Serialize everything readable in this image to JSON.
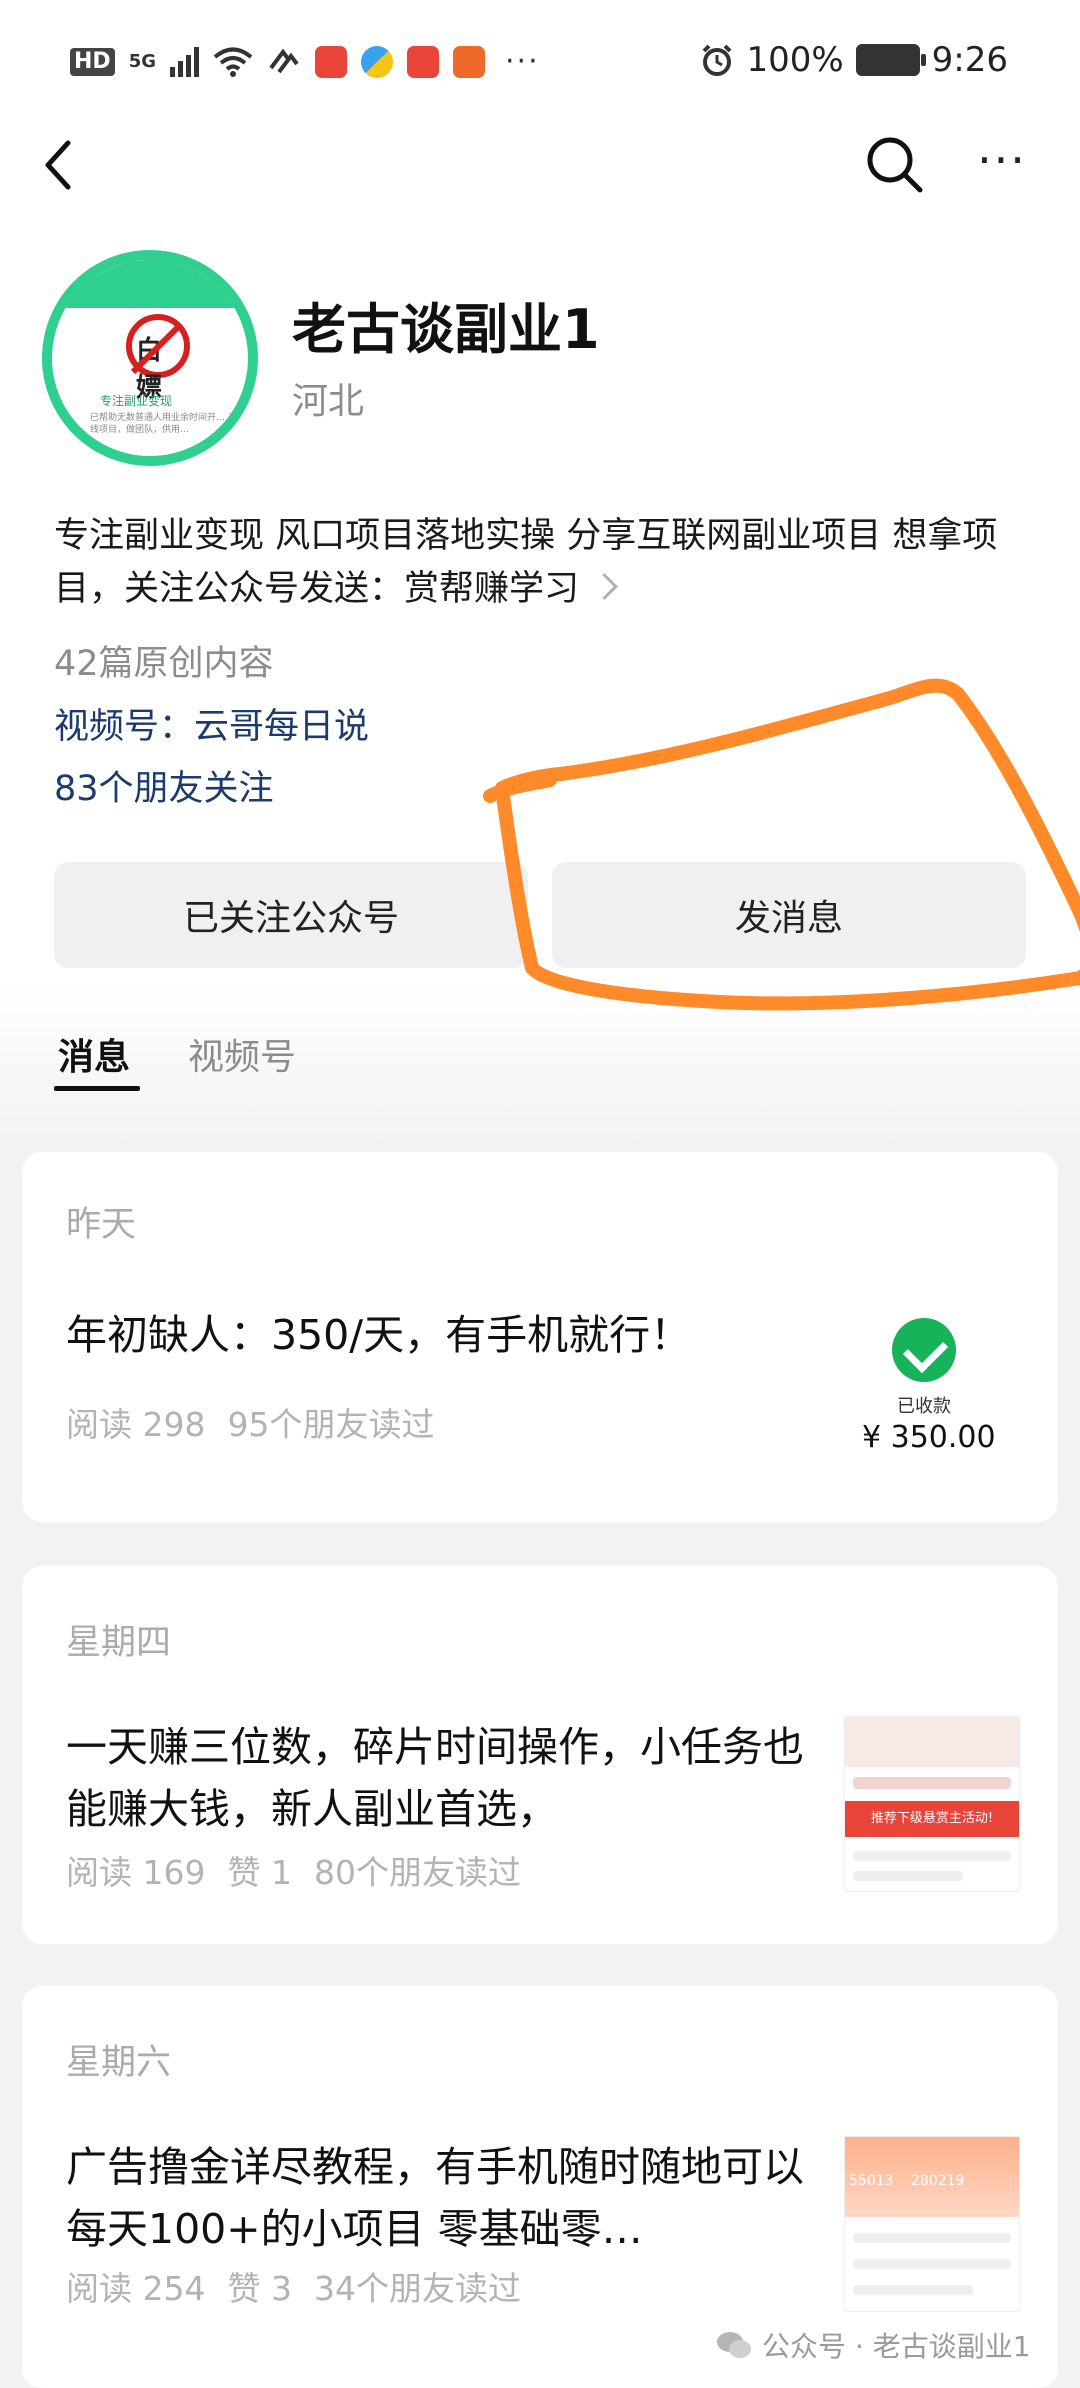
{
  "status_bar": {
    "left_tags": [
      "HD",
      "5G"
    ],
    "battery": "100%",
    "time": "9:26",
    "more": "···"
  },
  "nav": {
    "more": "···"
  },
  "profile": {
    "name": "老古谈副业1",
    "region": "河北",
    "description": "专注副业变现 风口项目落地实操 分享互联网副业项目 想拿项目，关注公众号发送：赏帮赚学习",
    "original_count": "42篇原创内容",
    "video_channel": "视频号：云哥每日说",
    "friends_following": "83个朋友关注",
    "avatar_text": {
      "sign": "白嫖",
      "line1": "专注副业变现",
      "line2": "已帮助无数普通人用业余时间开… 在线项目，做团队，供用…"
    }
  },
  "actions": {
    "followed_label": "已关注公众号",
    "message_label": "发消息"
  },
  "tabs": [
    {
      "label": "消息",
      "active": true
    },
    {
      "label": "视频号",
      "active": false
    }
  ],
  "articles": [
    {
      "day": "昨天",
      "title": "年初缺人：350/天，有手机就行！",
      "reads": "阅读 298",
      "likes": "",
      "friends_read": "95个朋友读过",
      "thumb": {
        "type": "payment",
        "status": "已收款",
        "amount": "¥ 350.00"
      }
    },
    {
      "day": "星期四",
      "title": "一天赚三位数，碎片时间操作，小任务也能赚大钱，新人副业首选，",
      "reads": "阅读 169",
      "likes": "赞 1",
      "friends_read": "80个朋友读过",
      "thumb": {
        "type": "app",
        "banner": "推荐下级悬赏主活动!"
      }
    },
    {
      "day": "星期六",
      "title": "广告撸金详尽教程，有手机随时随地可以 每天100+的小项目 零基础零…",
      "reads": "阅读 254",
      "likes": "赞 3",
      "friends_read": "34个朋友读过",
      "thumb": {
        "type": "app",
        "numbers": [
          "55013",
          "280219"
        ]
      }
    }
  ],
  "watermark": "公众号 · 老古谈副业1",
  "colors": {
    "accent_green": "#16b35a",
    "link_blue": "#1b3a6e",
    "annotation_orange": "#ff8a2a"
  }
}
